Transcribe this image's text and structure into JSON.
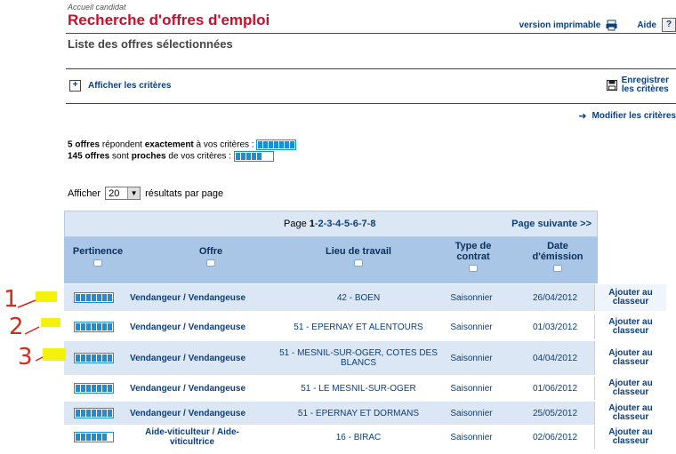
{
  "breadcrumb": "Accueil candidat",
  "title": "Recherche d'offres d'emploi",
  "subtitle": "Liste des offres sélectionnées",
  "top_links": {
    "print": "version imprimable",
    "help": "Aide",
    "help_icon": "?"
  },
  "criteria": {
    "show": "Afficher les critères",
    "save_line1": "Enregistrer",
    "save_line2": "les critères",
    "modify": "Modifier les critères"
  },
  "counts": {
    "exact_count": "5 offres",
    "exact_mid1": " répondent ",
    "exact_word": "exactement",
    "exact_end": " à vos critères : ",
    "near_count": "145 offres",
    "near_mid1": " sont ",
    "near_word": "proches",
    "near_end": " de vos critères : "
  },
  "per_page": {
    "prefix": "Afficher",
    "value": "20",
    "suffix": "résultats par page"
  },
  "pagination": {
    "label": "Page ",
    "current": "1",
    "pages": [
      "2",
      "3",
      "4",
      "5",
      "6",
      "7",
      "8"
    ],
    "next": "Page suivante >>"
  },
  "columns": {
    "pertinence": "Pertinence",
    "offre": "Offre",
    "lieu": "Lieu de travail",
    "type_l1": "Type de",
    "type_l2": "contrat",
    "date_l1": "Date",
    "date_l2": "d'émission"
  },
  "add_label_l1": "Ajouter au",
  "add_label_l2": "classeur",
  "rows": [
    {
      "pertinence": 1.0,
      "offre": "Vendangeur / Vendangeuse",
      "lieu": "42 - BOEN",
      "type": "Saisonnier",
      "date": "26/04/2012"
    },
    {
      "pertinence": 1.0,
      "offre": "Vendangeur / Vendangeuse",
      "lieu": "51 - EPERNAY ET ALENTOURS",
      "type": "Saisonnier",
      "date": "01/03/2012"
    },
    {
      "pertinence": 1.0,
      "offre": "Vendangeur / Vendangeuse",
      "lieu": "51 - MESNIL-SUR-OGER, COTES DES BLANCS",
      "type": "Saisonnier",
      "date": "04/04/2012"
    },
    {
      "pertinence": 1.0,
      "offre": "Vendangeur / Vendangeuse",
      "lieu": "51 - LE MESNIL-SUR-OGER",
      "type": "Saisonnier",
      "date": "01/06/2012"
    },
    {
      "pertinence": 1.0,
      "offre": "Vendangeur / Vendangeuse",
      "lieu": "51 - EPERNAY ET DORMANS",
      "type": "Saisonnier",
      "date": "25/05/2012"
    },
    {
      "pertinence": 0.8,
      "offre": "Aide-viticulteur / Aide- viticultrice",
      "lieu": "16 - BIRAC",
      "type": "Saisonnier",
      "date": "02/06/2012"
    }
  ],
  "colors": {
    "accent_red": "#c8102e",
    "link_blue": "#0b3f7c",
    "meter_blue": "#1b8fd6",
    "header_blue": "#a9c6e6",
    "highlight_yellow": "#f4f10a",
    "annotation_red": "#e0261b"
  },
  "annotations": [
    "1",
    "2",
    "3"
  ]
}
